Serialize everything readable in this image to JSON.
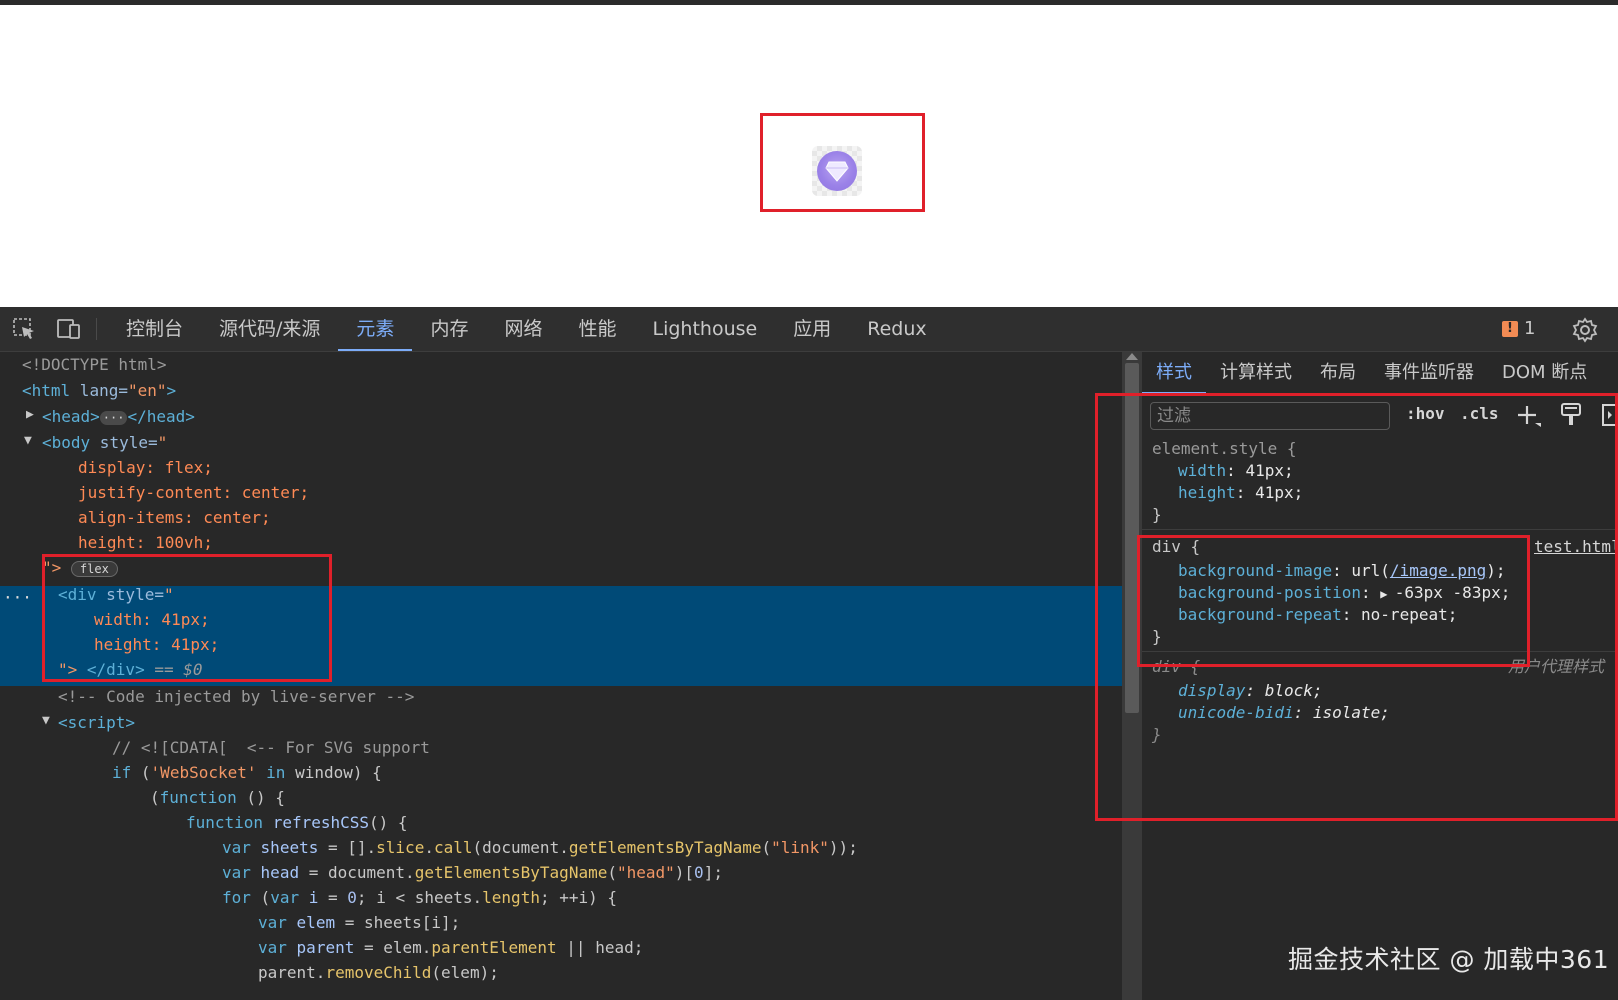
{
  "toolbar": {
    "tabs": [
      "控制台",
      "源代码/来源",
      "元素",
      "内存",
      "网络",
      "性能",
      "Lighthouse",
      "应用",
      "Redux"
    ],
    "active_tab": "元素",
    "issue_count": "1"
  },
  "dom": {
    "doctype": "<!DOCTYPE html>",
    "html_open_tag": "<html",
    "html_attr": " lang=",
    "html_val": "\"en\"",
    "html_close": ">",
    "head_open": "<head>",
    "head_close": "</head>",
    "head_ellipsis": "···",
    "body_open": "<body",
    "body_attr": " style=",
    "body_quote": "\"",
    "body_styles": [
      "display: flex;",
      "justify-content: center;",
      "align-items: center;",
      "height: 100vh;"
    ],
    "body_end": "\">",
    "flex_badge": "flex",
    "div_open": "<div",
    "div_attr": " style=",
    "div_quote": "\"",
    "div_styles": [
      "width: 41px;",
      "height: 41px;"
    ],
    "div_end_quote": "\">",
    "div_close": " </div>",
    "div_ref": " == $0",
    "comment": "<!-- Code injected by live-server -->",
    "script_open": "<script>",
    "code": [
      "// <![CDATA[  <-- For SVG support",
      "if ('WebSocket' in window) {",
      "(function () {",
      "function refreshCSS() {",
      "var sheets = [].slice.call(document.getElementsByTagName(\"link\"));",
      "var head = document.getElementsByTagName(\"head\")[0];",
      "for (var i = 0; i < sheets.length; ++i) {",
      "var elem = sheets[i];",
      "var parent = elem.parentElement || head;",
      "parent.removeChild(elem);"
    ]
  },
  "styles_panel": {
    "tabs": [
      "样式",
      "计算样式",
      "布局",
      "事件监听器",
      "DOM 断点"
    ],
    "active_tab": "样式",
    "filter_placeholder": "过滤",
    "hov": ":hov",
    "cls": ".cls",
    "rules": [
      {
        "selector": "element.style {",
        "decls": [
          [
            "width",
            "41px"
          ],
          [
            "height",
            "41px"
          ]
        ],
        "close": "}"
      },
      {
        "selector": "div {",
        "source": "test.html",
        "decls": [
          [
            "background-image",
            "url(",
            "/image.png",
            ");"
          ],
          [
            "background-position",
            "-63px -83px;"
          ],
          [
            "background-repeat",
            "no-repeat;"
          ]
        ],
        "close": "}"
      },
      {
        "selector": "div {",
        "source": "用户代理样式",
        "decls": [
          [
            "display",
            "block;"
          ],
          [
            "unicode-bidi",
            "isolate;"
          ]
        ],
        "close": "}"
      }
    ]
  },
  "watermark": "掘金技术社区 @ 加载中361",
  "colors": {
    "highlight_box": "#e0202a",
    "selected_row": "#004a77",
    "accent": "#7cacf8"
  }
}
